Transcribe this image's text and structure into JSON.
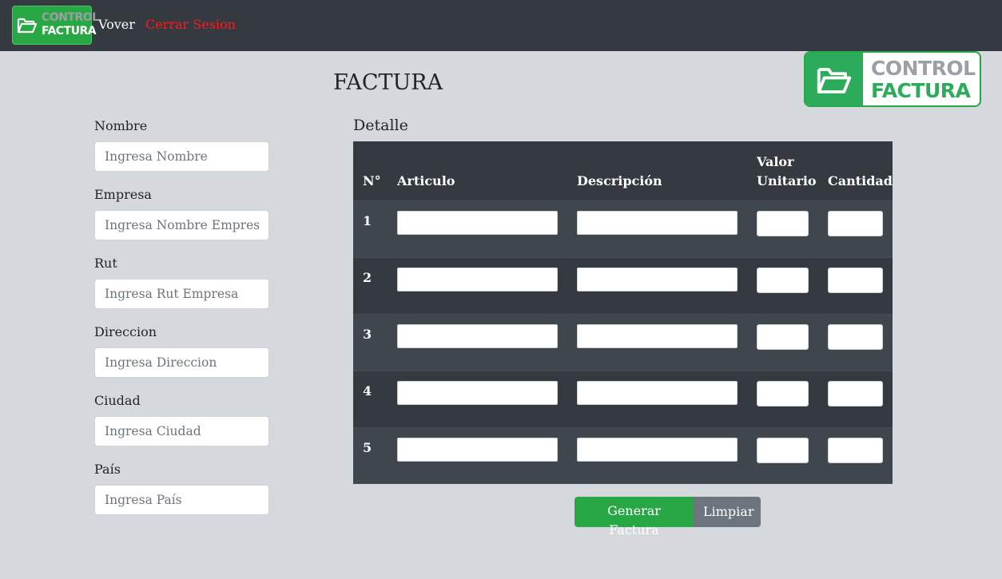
{
  "navbar": {
    "logo": {
      "line1": "CONTROL",
      "line2": "FACTURA"
    },
    "links": {
      "back": "Vover",
      "logout": "Cerrar Sesion"
    }
  },
  "page": {
    "title": "FACTURA"
  },
  "brand_logo": {
    "line1": "CONTROL",
    "line2": "FACTURA"
  },
  "form": {
    "fields": [
      {
        "label": "Nombre",
        "placeholder": "Ingresa Nombre",
        "value": ""
      },
      {
        "label": "Empresa",
        "placeholder": "Ingresa Nombre Empresa",
        "value": ""
      },
      {
        "label": "Rut",
        "placeholder": "Ingresa Rut Empresa",
        "value": ""
      },
      {
        "label": "Direccion",
        "placeholder": "Ingresa Direccion",
        "value": ""
      },
      {
        "label": "Ciudad",
        "placeholder": "Ingresa Ciudad",
        "value": ""
      },
      {
        "label": "País",
        "placeholder": "Ingresa País",
        "value": ""
      }
    ]
  },
  "detail": {
    "title": "Detalle",
    "columns": [
      "N°",
      "Articulo",
      "Descripción",
      "Valor Unitario",
      "Cantidad"
    ],
    "rows": [
      {
        "num": "1",
        "articulo": "",
        "descripcion": "",
        "valor": "",
        "cantidad": ""
      },
      {
        "num": "2",
        "articulo": "",
        "descripcion": "",
        "valor": "",
        "cantidad": ""
      },
      {
        "num": "3",
        "articulo": "",
        "descripcion": "",
        "valor": "",
        "cantidad": ""
      },
      {
        "num": "4",
        "articulo": "",
        "descripcion": "",
        "valor": "",
        "cantidad": ""
      },
      {
        "num": "5",
        "articulo": "",
        "descripcion": "",
        "valor": "",
        "cantidad": ""
      }
    ]
  },
  "actions": {
    "generate": "Generar Factura",
    "clear": "Limpiar"
  },
  "colors": {
    "navbar": "#343a40",
    "brand_green": "#28a745",
    "logout": "#ff1a1a",
    "page_bg": "#d5d8dc",
    "table_dark": "#343a40",
    "table_stripe": "#3f464d",
    "secondary": "#6c757d"
  },
  "icons": {
    "logo": "folder-open-icon"
  }
}
